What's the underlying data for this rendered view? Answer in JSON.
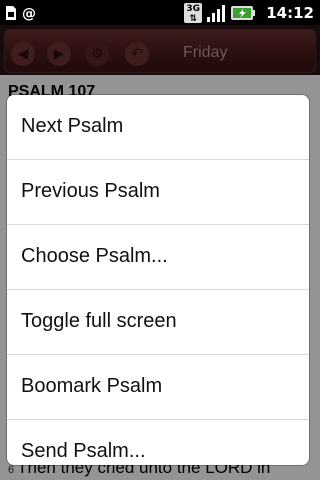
{
  "status_bar": {
    "icons": [
      "sim-toolkit-icon",
      "email-icon",
      "3g-icon",
      "signal-icon",
      "battery-charging-icon"
    ],
    "net_label": "3G",
    "time": "14:12"
  },
  "toolbar": {
    "title": "Friday",
    "icons": [
      "back-icon",
      "forward-icon",
      "settings-icon",
      "return-icon"
    ]
  },
  "content": {
    "psalm_title": "PSALM 107",
    "edge_fragments": [
      "1",
      "h",
      "f",
      "2",
      "s",
      "f",
      "3",
      "l",
      "w",
      "4",
      "i",
      "t",
      "5",
      "f"
    ],
    "bottom_verse_number": "6",
    "bottom_verse_text": "Then they cried unto the LORD in"
  },
  "menu": {
    "items": [
      {
        "label": "Next Psalm"
      },
      {
        "label": "Previous Psalm"
      },
      {
        "label": "Choose Psalm..."
      },
      {
        "label": "Toggle full screen"
      },
      {
        "label": "Boomark Psalm"
      },
      {
        "label": "Send Psalm..."
      }
    ]
  }
}
